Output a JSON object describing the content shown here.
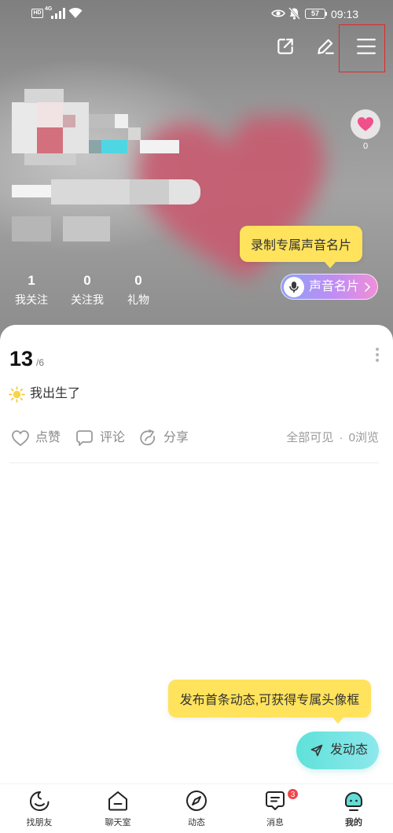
{
  "status_bar": {
    "hd_label": "HD",
    "signal_type": "4G",
    "battery": "57",
    "time": "09:13"
  },
  "header": {
    "icons": [
      "share-icon",
      "edit-icon",
      "menu-icon"
    ]
  },
  "profile": {
    "like_count": "0",
    "stats": [
      {
        "value": "1",
        "label": "我关注"
      },
      {
        "value": "0",
        "label": "关注我"
      },
      {
        "value": "0",
        "label": "礼物"
      }
    ]
  },
  "voice_card": {
    "tooltip": "录制专属声音名片",
    "button_label": "声音名片"
  },
  "post": {
    "day": "13",
    "month": "/6",
    "content": "我出生了",
    "actions": [
      {
        "label": "点赞",
        "icon": "heart-outline-icon"
      },
      {
        "label": "评论",
        "icon": "comment-icon"
      },
      {
        "label": "分享",
        "icon": "share-arrow-icon"
      }
    ],
    "visibility": "全部可见",
    "separator": "·",
    "views": "0浏览"
  },
  "publish": {
    "tooltip": "发布首条动态,可获得专属头像框",
    "button_label": "发动态"
  },
  "nav": {
    "items": [
      {
        "label": "找朋友",
        "icon": "find-friends-icon"
      },
      {
        "label": "聊天室",
        "icon": "chatroom-icon"
      },
      {
        "label": "动态",
        "icon": "compass-icon"
      },
      {
        "label": "消息",
        "icon": "message-icon",
        "badge": "3"
      },
      {
        "label": "我的",
        "icon": "profile-face-icon",
        "active": true
      }
    ]
  },
  "colors": {
    "tooltip_yellow": "#ffe35c",
    "badge_red": "#f0454a",
    "active_teal": "#62dcd4",
    "like_pink": "#f0508a",
    "highlight_red": "#e02828"
  }
}
